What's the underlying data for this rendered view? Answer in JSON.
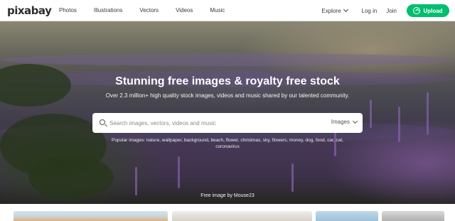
{
  "header": {
    "logo": "pixabay",
    "nav": [
      "Photos",
      "Illustrations",
      "Vectors",
      "Videos",
      "Music"
    ],
    "explore_label": "Explore",
    "login_label": "Log in",
    "join_label": "Join",
    "upload_label": "Upload"
  },
  "hero": {
    "title": "Stunning free images & royalty free stock",
    "subtitle": "Over 2.3 million+ high quality stock images, videos and music shared by our talented community.",
    "search": {
      "placeholder": "Search images, vectors, videos and music",
      "type_selected": "Images"
    },
    "popular_line1": "Popular images: nature, wallpaper, background, beach, flower, christmas, sky, flowers, money, dog, food, car, cat,",
    "popular_line2": "coronavirus",
    "credit": "Free image by Mouse23"
  },
  "colors": {
    "accent_green": "#02be6e",
    "text_dark": "#3a3a3a"
  },
  "icons": {
    "search": "search-icon",
    "upload": "upload-icon",
    "explore": "chevron-down-icon",
    "type_select": "chevron-down-icon"
  }
}
